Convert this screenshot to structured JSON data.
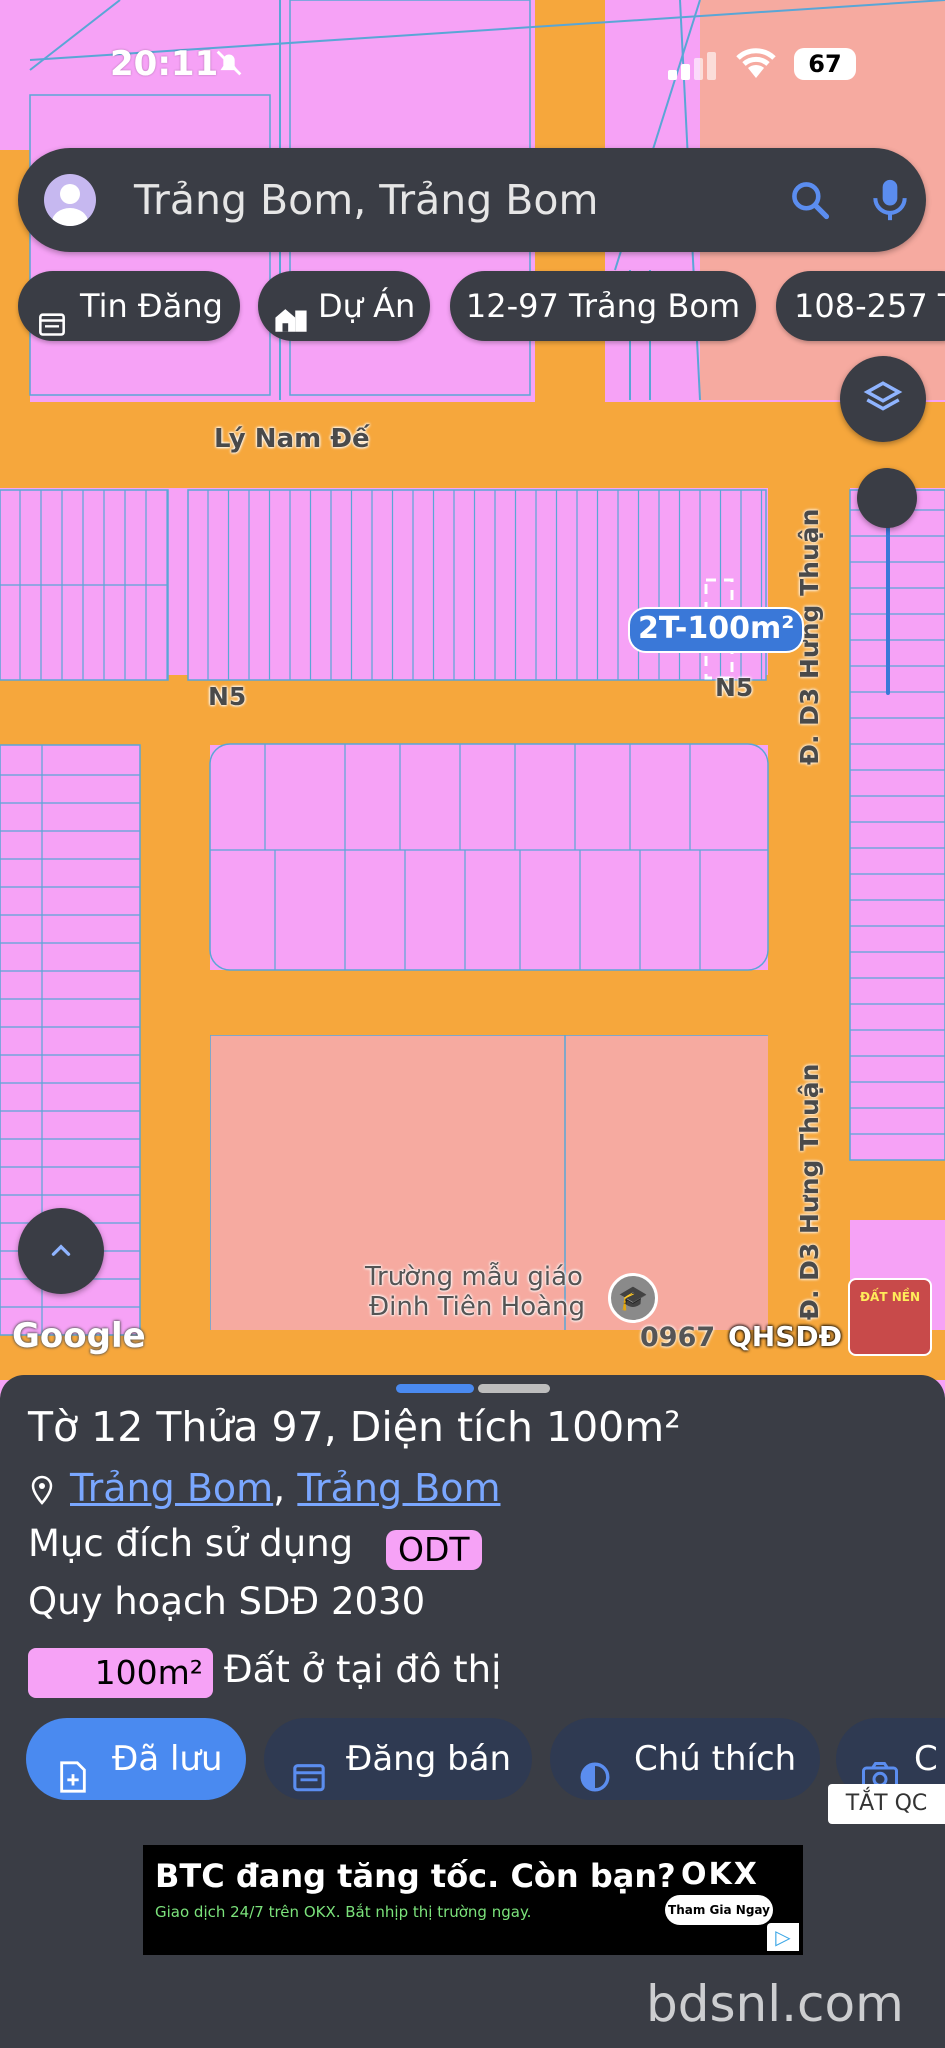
{
  "status_bar": {
    "time": "20:11",
    "battery": "67"
  },
  "search": {
    "query": "Trảng Bom, Trảng Bom"
  },
  "chips": [
    {
      "label": "Tin Đăng",
      "icon": "calendar-icon"
    },
    {
      "label": "Dự Án",
      "icon": "building-icon"
    },
    {
      "label": "12-97 Trảng Bom"
    },
    {
      "label": "108-257 T"
    }
  ],
  "map": {
    "road_labels": [
      "Lý Nam Đế",
      "N5",
      "N5",
      "Đ. D3 Hưng Thuận",
      "Đ. D3 Hưng Thuận"
    ],
    "parcel_label": "2T-100m²",
    "poi": {
      "line1": "Trường mẫu giáo",
      "line2": "Đinh Tiên Hoàng"
    },
    "google_logo": "Google",
    "phone_fragment": "0967",
    "plan_tag": "QHSDĐ 2030",
    "thumb_text": "ĐẤT NỀN",
    "colors": {
      "road": "#f6a73c",
      "residential": "#f6a2f6",
      "education": "#f6aaa0",
      "line": "#5aa6d6"
    }
  },
  "panel": {
    "title": "Tờ 12 Thửa 97, Diện tích 100m²",
    "location": {
      "part1": "Trảng Bom",
      "sep": ",",
      "part2": "Trảng Bom"
    },
    "purpose_label": "Mục đích sử dụng",
    "purpose_code": "ODT",
    "plan_label": "Quy hoạch SDĐ 2030",
    "area_value": "100m²",
    "area_desc": "Đất ở tại đô thị",
    "buttons": [
      {
        "label": "Đã lưu",
        "icon": "add-file-icon"
      },
      {
        "label": "Đăng bán",
        "icon": "calendar-icon"
      },
      {
        "label": "Chú thích",
        "icon": "contrast-icon"
      },
      {
        "label": "C",
        "icon": "camera-icon"
      }
    ],
    "ad_close": "TẮT QC"
  },
  "ad": {
    "headline": "BTC đang tăng tốc. Còn bạn?",
    "brand": "OKX",
    "cta": "Tham Gia Ngay",
    "subline": "Giao dịch 24/7 trên OKX. Bắt nhịp thị trường ngay."
  },
  "watermark": "bdsnl.com"
}
